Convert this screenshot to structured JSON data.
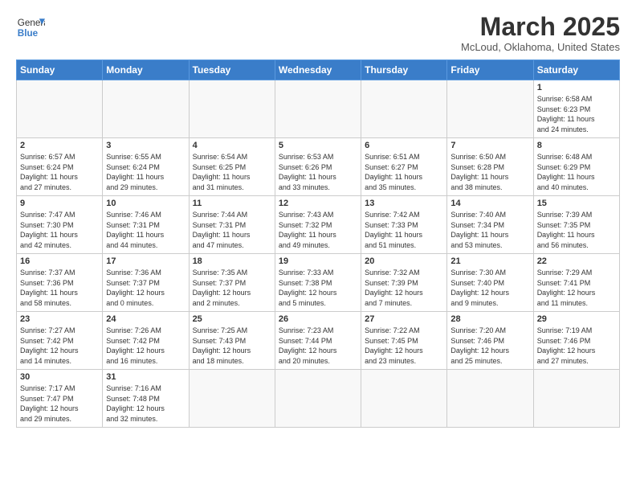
{
  "header": {
    "logo_general": "General",
    "logo_blue": "Blue",
    "month_title": "March 2025",
    "location": "McLoud, Oklahoma, United States"
  },
  "weekdays": [
    "Sunday",
    "Monday",
    "Tuesday",
    "Wednesday",
    "Thursday",
    "Friday",
    "Saturday"
  ],
  "weeks": [
    [
      {
        "day": "",
        "info": ""
      },
      {
        "day": "",
        "info": ""
      },
      {
        "day": "",
        "info": ""
      },
      {
        "day": "",
        "info": ""
      },
      {
        "day": "",
        "info": ""
      },
      {
        "day": "",
        "info": ""
      },
      {
        "day": "1",
        "info": "Sunrise: 6:58 AM\nSunset: 6:23 PM\nDaylight: 11 hours\nand 24 minutes."
      }
    ],
    [
      {
        "day": "2",
        "info": "Sunrise: 6:57 AM\nSunset: 6:24 PM\nDaylight: 11 hours\nand 27 minutes."
      },
      {
        "day": "3",
        "info": "Sunrise: 6:55 AM\nSunset: 6:24 PM\nDaylight: 11 hours\nand 29 minutes."
      },
      {
        "day": "4",
        "info": "Sunrise: 6:54 AM\nSunset: 6:25 PM\nDaylight: 11 hours\nand 31 minutes."
      },
      {
        "day": "5",
        "info": "Sunrise: 6:53 AM\nSunset: 6:26 PM\nDaylight: 11 hours\nand 33 minutes."
      },
      {
        "day": "6",
        "info": "Sunrise: 6:51 AM\nSunset: 6:27 PM\nDaylight: 11 hours\nand 35 minutes."
      },
      {
        "day": "7",
        "info": "Sunrise: 6:50 AM\nSunset: 6:28 PM\nDaylight: 11 hours\nand 38 minutes."
      },
      {
        "day": "8",
        "info": "Sunrise: 6:48 AM\nSunset: 6:29 PM\nDaylight: 11 hours\nand 40 minutes."
      }
    ],
    [
      {
        "day": "9",
        "info": "Sunrise: 7:47 AM\nSunset: 7:30 PM\nDaylight: 11 hours\nand 42 minutes."
      },
      {
        "day": "10",
        "info": "Sunrise: 7:46 AM\nSunset: 7:31 PM\nDaylight: 11 hours\nand 44 minutes."
      },
      {
        "day": "11",
        "info": "Sunrise: 7:44 AM\nSunset: 7:31 PM\nDaylight: 11 hours\nand 47 minutes."
      },
      {
        "day": "12",
        "info": "Sunrise: 7:43 AM\nSunset: 7:32 PM\nDaylight: 11 hours\nand 49 minutes."
      },
      {
        "day": "13",
        "info": "Sunrise: 7:42 AM\nSunset: 7:33 PM\nDaylight: 11 hours\nand 51 minutes."
      },
      {
        "day": "14",
        "info": "Sunrise: 7:40 AM\nSunset: 7:34 PM\nDaylight: 11 hours\nand 53 minutes."
      },
      {
        "day": "15",
        "info": "Sunrise: 7:39 AM\nSunset: 7:35 PM\nDaylight: 11 hours\nand 56 minutes."
      }
    ],
    [
      {
        "day": "16",
        "info": "Sunrise: 7:37 AM\nSunset: 7:36 PM\nDaylight: 11 hours\nand 58 minutes."
      },
      {
        "day": "17",
        "info": "Sunrise: 7:36 AM\nSunset: 7:37 PM\nDaylight: 12 hours\nand 0 minutes."
      },
      {
        "day": "18",
        "info": "Sunrise: 7:35 AM\nSunset: 7:37 PM\nDaylight: 12 hours\nand 2 minutes."
      },
      {
        "day": "19",
        "info": "Sunrise: 7:33 AM\nSunset: 7:38 PM\nDaylight: 12 hours\nand 5 minutes."
      },
      {
        "day": "20",
        "info": "Sunrise: 7:32 AM\nSunset: 7:39 PM\nDaylight: 12 hours\nand 7 minutes."
      },
      {
        "day": "21",
        "info": "Sunrise: 7:30 AM\nSunset: 7:40 PM\nDaylight: 12 hours\nand 9 minutes."
      },
      {
        "day": "22",
        "info": "Sunrise: 7:29 AM\nSunset: 7:41 PM\nDaylight: 12 hours\nand 11 minutes."
      }
    ],
    [
      {
        "day": "23",
        "info": "Sunrise: 7:27 AM\nSunset: 7:42 PM\nDaylight: 12 hours\nand 14 minutes."
      },
      {
        "day": "24",
        "info": "Sunrise: 7:26 AM\nSunset: 7:42 PM\nDaylight: 12 hours\nand 16 minutes."
      },
      {
        "day": "25",
        "info": "Sunrise: 7:25 AM\nSunset: 7:43 PM\nDaylight: 12 hours\nand 18 minutes."
      },
      {
        "day": "26",
        "info": "Sunrise: 7:23 AM\nSunset: 7:44 PM\nDaylight: 12 hours\nand 20 minutes."
      },
      {
        "day": "27",
        "info": "Sunrise: 7:22 AM\nSunset: 7:45 PM\nDaylight: 12 hours\nand 23 minutes."
      },
      {
        "day": "28",
        "info": "Sunrise: 7:20 AM\nSunset: 7:46 PM\nDaylight: 12 hours\nand 25 minutes."
      },
      {
        "day": "29",
        "info": "Sunrise: 7:19 AM\nSunset: 7:46 PM\nDaylight: 12 hours\nand 27 minutes."
      }
    ],
    [
      {
        "day": "30",
        "info": "Sunrise: 7:17 AM\nSunset: 7:47 PM\nDaylight: 12 hours\nand 29 minutes."
      },
      {
        "day": "31",
        "info": "Sunrise: 7:16 AM\nSunset: 7:48 PM\nDaylight: 12 hours\nand 32 minutes."
      },
      {
        "day": "",
        "info": ""
      },
      {
        "day": "",
        "info": ""
      },
      {
        "day": "",
        "info": ""
      },
      {
        "day": "",
        "info": ""
      },
      {
        "day": "",
        "info": ""
      }
    ]
  ]
}
